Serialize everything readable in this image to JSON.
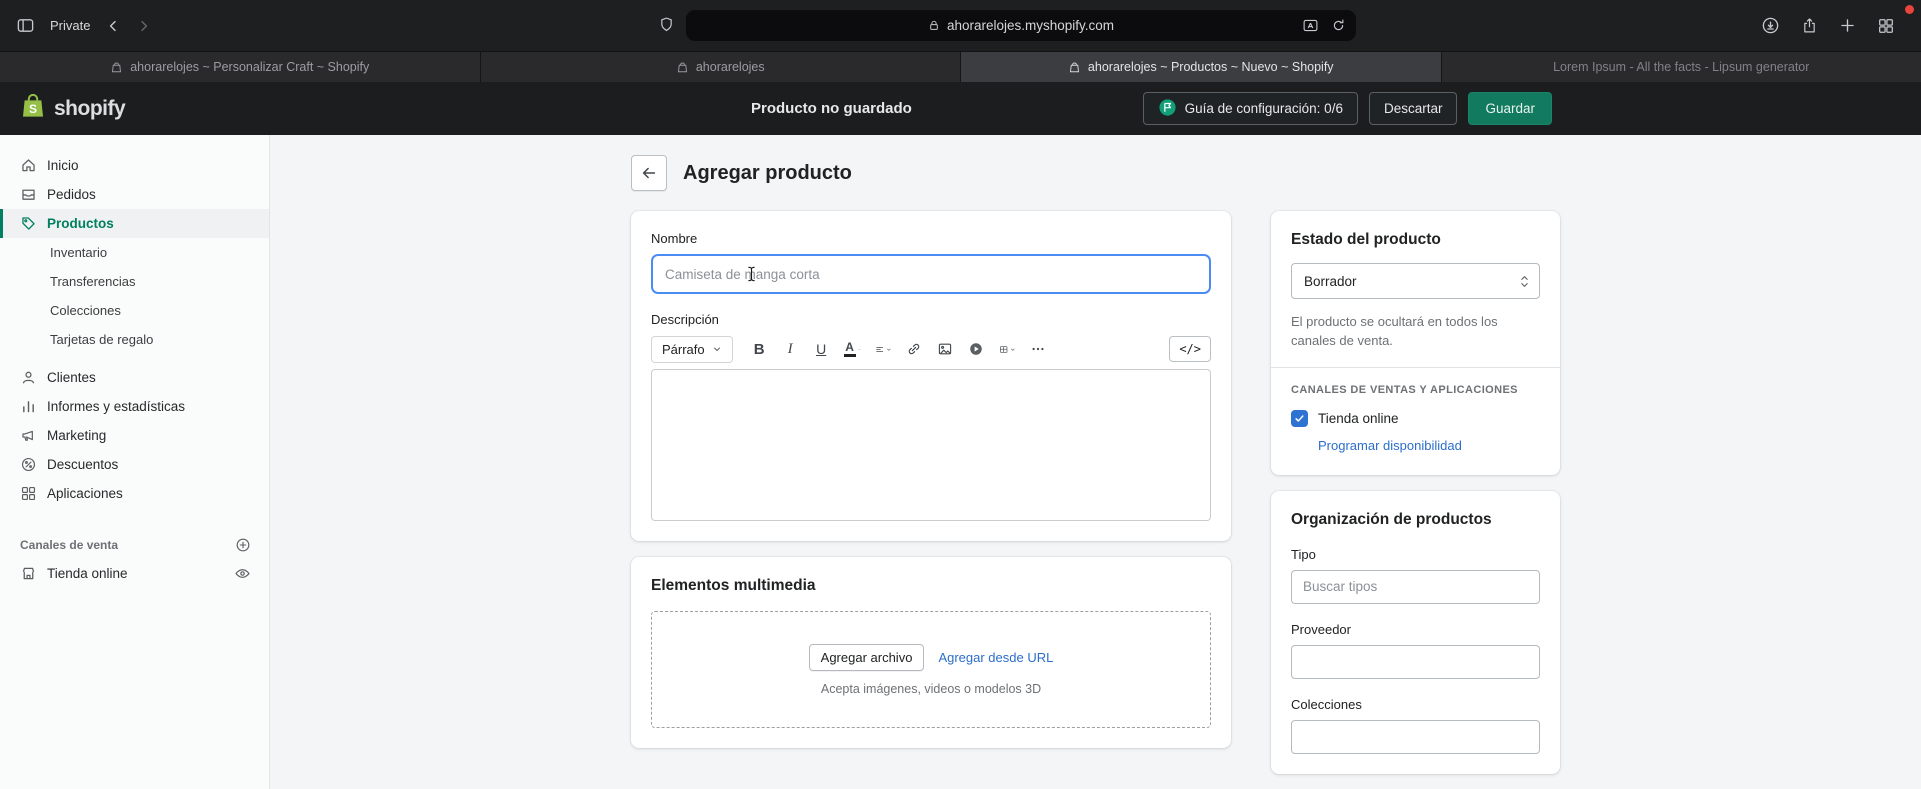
{
  "colors": {
    "brand_green": "#008060",
    "link_blue": "#2c6ecb",
    "focus_blue": "#4b8bf4",
    "checkbox_blue": "#2e72d2",
    "save_button_green": "#127a5f"
  },
  "browser": {
    "private_label": "Private",
    "url": "ahorarelojes.myshopify.com",
    "tabs": [
      {
        "title": "ahorarelojes ~ Personalizar Craft ~ Shopify"
      },
      {
        "title": "ahorarelojes"
      },
      {
        "title": "ahorarelojes ~ Productos ~ Nuevo ~ Shopify"
      },
      {
        "title": "Lorem Ipsum - All the facts - Lipsum generator"
      }
    ]
  },
  "header": {
    "logo_text": "shopify",
    "unsaved_label": "Producto no guardado",
    "setup_guide_label": "Guía de configuración: 0/6",
    "discard_label": "Descartar",
    "save_label": "Guardar"
  },
  "sidebar": {
    "items": [
      {
        "label": "Inicio"
      },
      {
        "label": "Pedidos"
      },
      {
        "label": "Productos"
      },
      {
        "label": "Inventario"
      },
      {
        "label": "Transferencias"
      },
      {
        "label": "Colecciones"
      },
      {
        "label": "Tarjetas de regalo"
      },
      {
        "label": "Clientes"
      },
      {
        "label": "Informes y estadísticas"
      },
      {
        "label": "Marketing"
      },
      {
        "label": "Descuentos"
      },
      {
        "label": "Aplicaciones"
      }
    ],
    "sales_channels_header": "Canales de venta",
    "online_store_label": "Tienda online"
  },
  "page": {
    "title": "Agregar producto",
    "name_label": "Nombre",
    "name_placeholder": "Camiseta de manga corta",
    "description_label": "Descripción",
    "editor_paragraph_label": "Párrafo",
    "editor_code_label": "</>",
    "media": {
      "title": "Elementos multimedia",
      "add_file_label": "Agregar archivo",
      "add_url_label": "Agregar desde URL",
      "hint": "Acepta imágenes, videos o modelos 3D"
    }
  },
  "status_card": {
    "title": "Estado del producto",
    "selected_status": "Borrador",
    "hint": "El producto se ocultará en todos los canales de venta.",
    "channels_header": "CANALES DE VENTAS Y APLICACIONES",
    "online_store_label": "Tienda online",
    "schedule_link": "Programar disponibilidad"
  },
  "organization_card": {
    "title": "Organización de productos",
    "type_label": "Tipo",
    "type_placeholder": "Buscar tipos",
    "vendor_label": "Proveedor",
    "collections_label": "Colecciones"
  }
}
